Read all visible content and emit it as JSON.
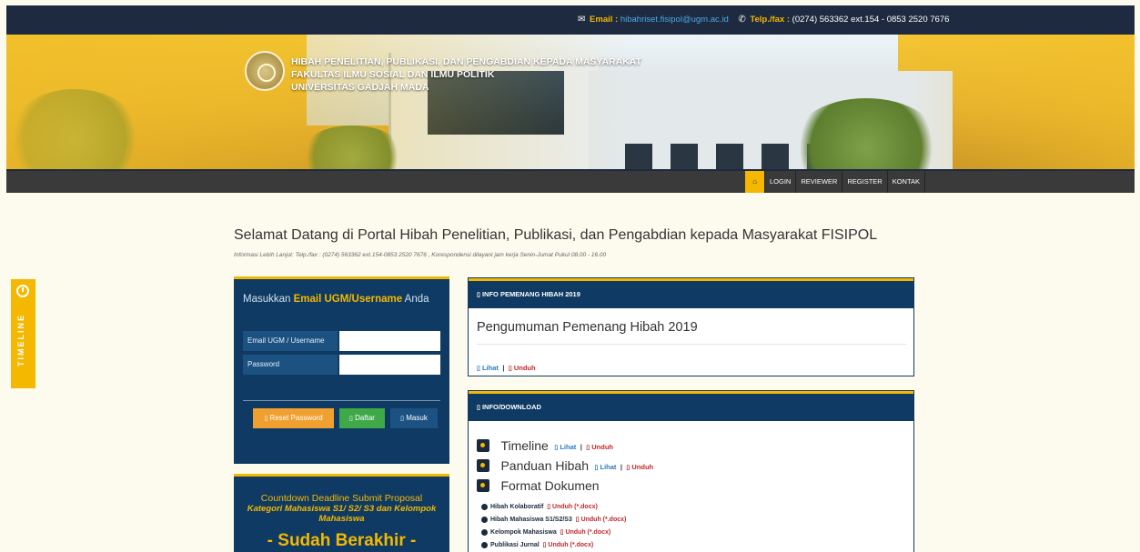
{
  "topbar": {
    "email_label": "Email :",
    "email_value": "hibahriset.fisipol@ugm.ac.id",
    "phone_label": "Telp./fax :",
    "phone_value": "(0274) 563362 ext.154 - 0853 2520 7676"
  },
  "banner": {
    "line1": "HIBAH PENELITIAN, PUBLIKASI, DAN PENGABDIAN KEPADA MASYARAKAT",
    "line2": "FAKULTAS ILMU SOSIAL DAN ILMU POLITIK",
    "line3": "UNIVERSITAS GADJAH MADA"
  },
  "nav": {
    "home_icon": "home-icon",
    "login": "LOGIN",
    "reviewer": "REVIEWER",
    "register": "REGISTER",
    "kontak": "KONTAK"
  },
  "welcome": {
    "title": "Selamat Datang di Portal Hibah Penelitian, Publikasi, dan Pengabdian kepada Masyarakat FISIPOL",
    "subtitle": "Informasi Lebih Lanjut: Telp./fax : (0274) 563362 ext.154-0853 2520 7676 , Korespondensi dilayani jam kerja Senin-Jumat Pukul 08.00 - 16.00"
  },
  "timeline_tab": {
    "label": "TIMELINE"
  },
  "login": {
    "heading_pre": "Masukkan ",
    "heading_bold": "Email UGM/Username",
    "heading_post": " Anda",
    "email_label": "Email UGM / Username",
    "password_label": "Password",
    "reset_button": "Reset Password",
    "daftar_button": "Daftar",
    "masuk_button": "Masuk"
  },
  "countdown": {
    "title": "Countdown Deadline Submit Proposal",
    "category": "Kategori Mahasiswa S1/ S2/ S3 dan Kelompok Mahasiswa",
    "status": "- Sudah Berakhir -"
  },
  "panel_winner": {
    "header": "INFO PEMENANG HIBAH 2019",
    "title": "Pengumuman Pemenang Hibah 2019",
    "lihat": "Lihat",
    "unduh": "Unduh"
  },
  "panel_download": {
    "header": "INFO/DOWNLOAD",
    "timeline": "Timeline",
    "panduan": "Panduan Hibah",
    "format": "Format Dokumen",
    "lihat": "Lihat",
    "unduh": "Unduh",
    "docs": [
      {
        "name": "Hibah Kolaboratif",
        "unduh": "Unduh (*.docx)"
      },
      {
        "name": "Hibah Mahasiswa S1/S2/S3",
        "unduh": "Unduh (*.docx)"
      },
      {
        "name": "Kelompok Mahasiswa",
        "unduh": "Unduh (*.docx)"
      },
      {
        "name": "Publikasi Jurnal",
        "unduh": "Unduh (*.docx)"
      }
    ]
  }
}
